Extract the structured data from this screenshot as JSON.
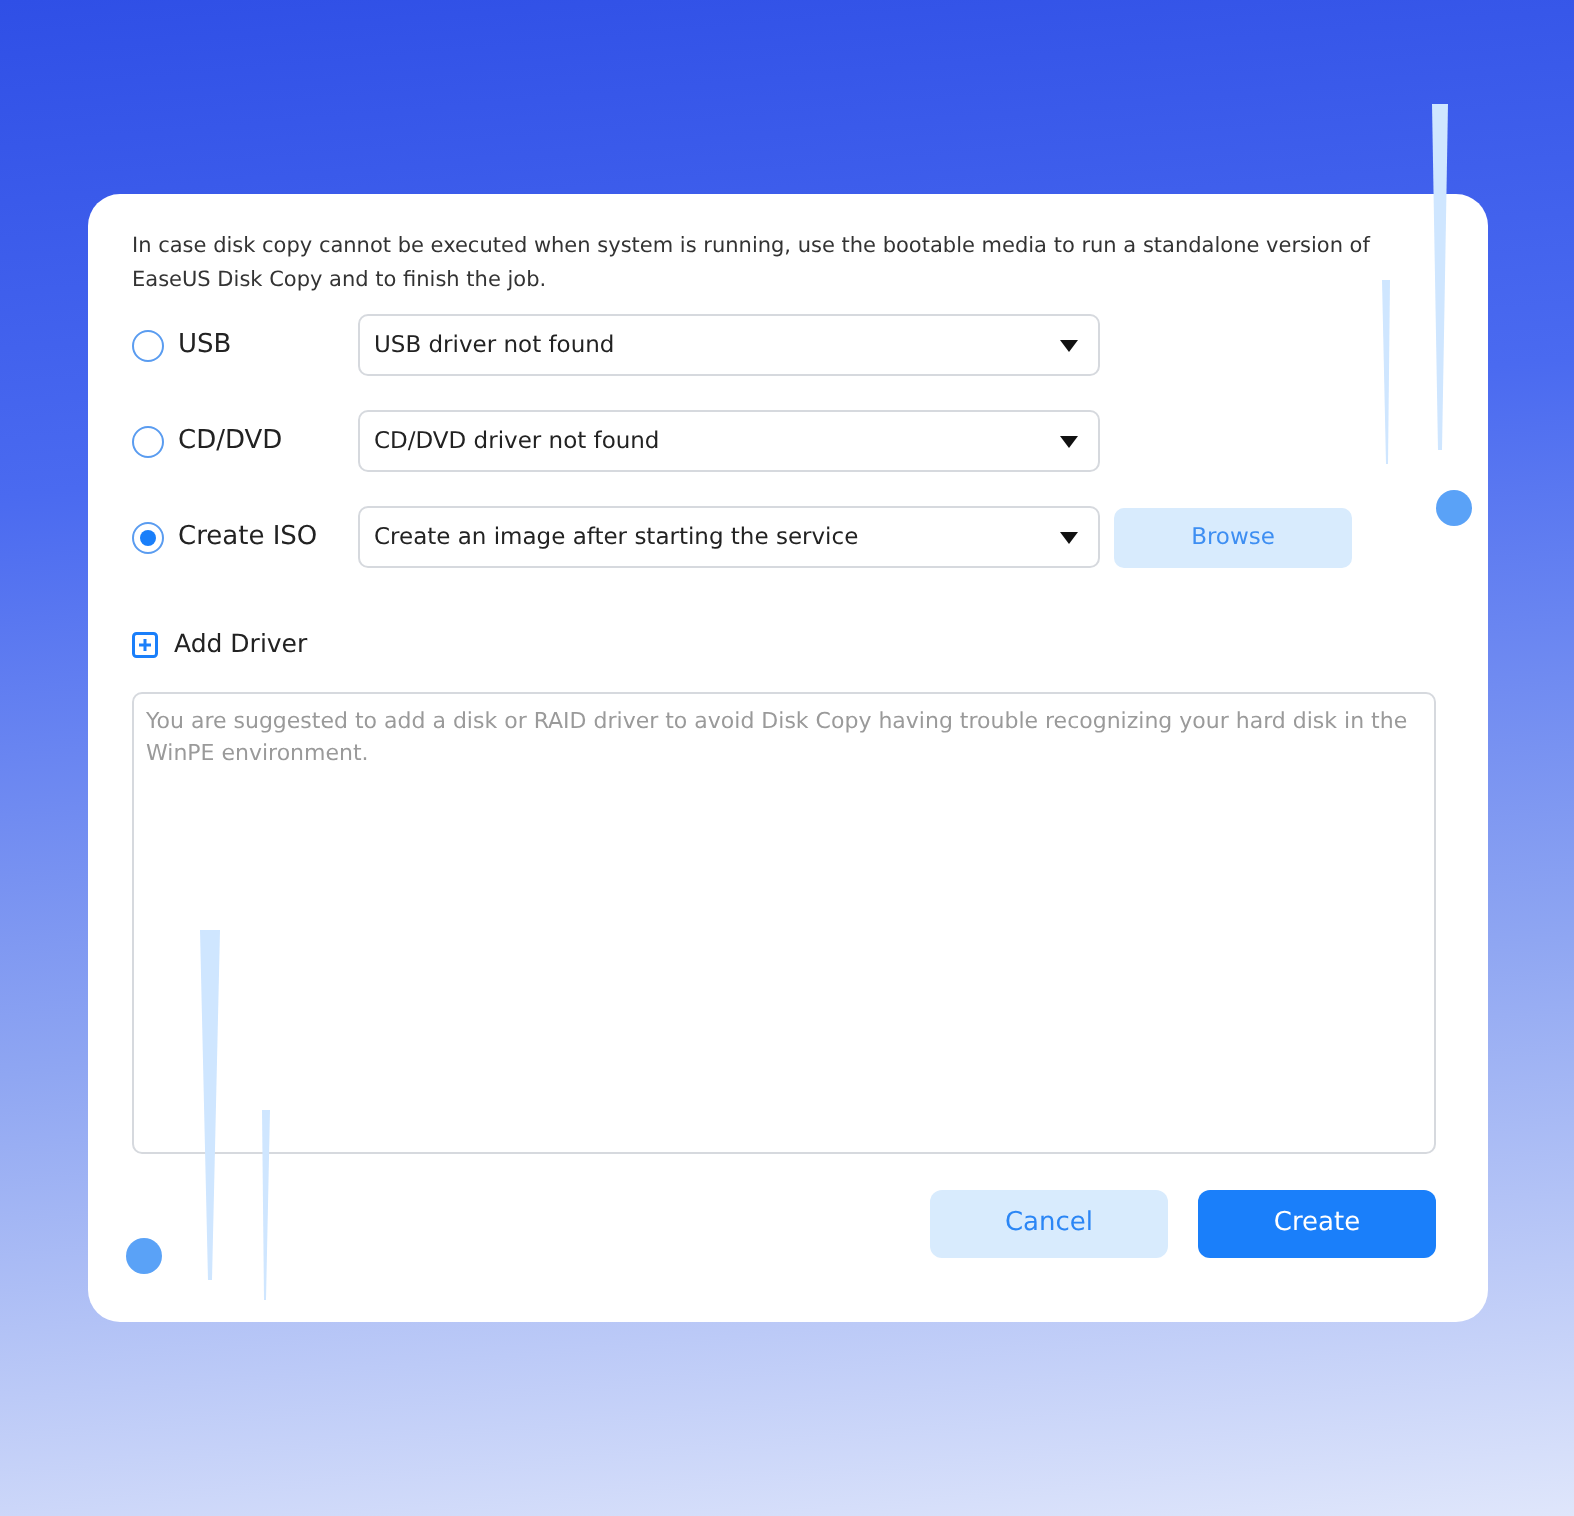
{
  "description": "In case disk copy cannot be executed when system is running, use the bootable media to run a standalone version of EaseUS Disk Copy and to finish the job.",
  "options": [
    {
      "label": "USB",
      "selected": false,
      "dropdown": "USB driver not found"
    },
    {
      "label": "CD/DVD",
      "selected": false,
      "dropdown": "CD/DVD driver not found"
    },
    {
      "label": "Create ISO",
      "selected": true,
      "dropdown": "Create an image after starting the service",
      "button": "Browse"
    }
  ],
  "add_driver": {
    "label": "Add Driver"
  },
  "driver_notes": {
    "placeholder": "You are suggested to add a disk or RAID driver to avoid Disk Copy having trouble recognizing your hard disk in the WinPE environment."
  },
  "buttons": [
    {
      "label": "Cancel",
      "kind": "secondary"
    },
    {
      "label": "Create",
      "kind": "primary"
    }
  ]
}
